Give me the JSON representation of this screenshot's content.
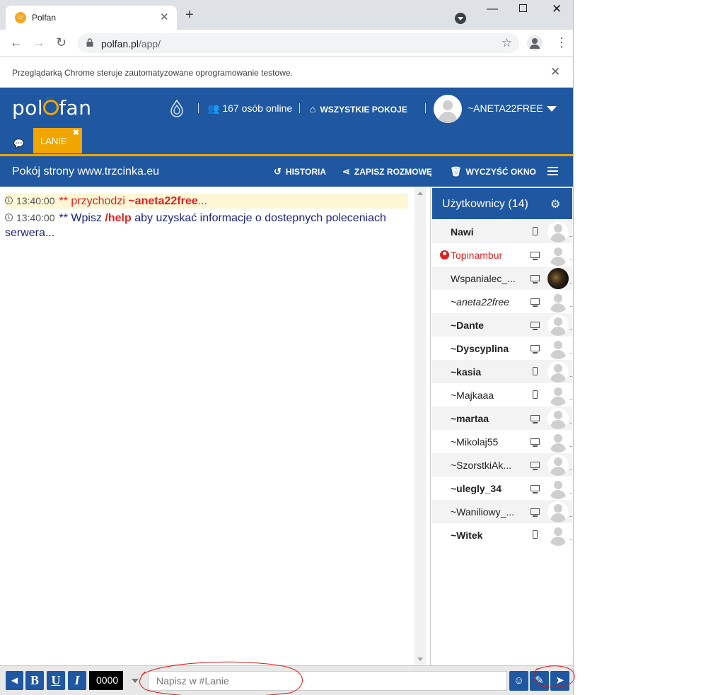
{
  "browser": {
    "tab_title": "Polfan",
    "tab_favicon": "polfan-favicon",
    "url_host": "polfan.pl",
    "url_path": "/app/",
    "infobar_text": "Przeglądarką Chrome steruje zautomatyzowane oprogramowanie testowe."
  },
  "header": {
    "logo": "polfan",
    "online_count": "167 osób online",
    "all_rooms": "WSZYSTKIE POKOJE",
    "username": "~ANETA22FREE",
    "room_tab": "LANIE"
  },
  "roombar": {
    "title": "Pokój strony www.trzcinka.eu",
    "history": "HISTORIA",
    "save": "ZAPISZ ROZMOWĘ",
    "clear": "WYCZYŚĆ OKNO"
  },
  "messages": [
    {
      "time": "13:40:00",
      "prefix": "** przychodzi ",
      "nick": "~aneta22free",
      "suffix": "..."
    },
    {
      "time": "13:40:00",
      "prefix": "** Wpisz ",
      "cmd": "/help",
      "suffix": " aby uzyskać informacje o dostepnych poleceniach serwera..."
    }
  ],
  "users_panel": {
    "title": "Użytkownicy (14)",
    "users": [
      {
        "name": "Nawi",
        "style": "bold",
        "device": "phone",
        "avatar": "default"
      },
      {
        "name": "Topinambur",
        "style": "red",
        "device": "pc",
        "avatar": "default",
        "status": "red-user-icon"
      },
      {
        "name": "Wspanialec_...",
        "style": "normal",
        "device": "pc",
        "avatar": "photo"
      },
      {
        "name": "~aneta22free",
        "style": "italic",
        "device": "pc",
        "avatar": "default"
      },
      {
        "name": "~Dante",
        "style": "bold",
        "device": "pc",
        "avatar": "default"
      },
      {
        "name": "~Dyscyplina",
        "style": "bold",
        "device": "pc",
        "avatar": "default"
      },
      {
        "name": "~kasia",
        "style": "bold",
        "device": "phone",
        "avatar": "default"
      },
      {
        "name": "~Majkaaa",
        "style": "normal",
        "device": "phone",
        "avatar": "default"
      },
      {
        "name": "~martaa",
        "style": "bold",
        "device": "pc",
        "avatar": "default"
      },
      {
        "name": "~Mikolaj55",
        "style": "normal",
        "device": "pc",
        "avatar": "default"
      },
      {
        "name": "~SzorstkiAk...",
        "style": "normal",
        "device": "pc",
        "avatar": "default"
      },
      {
        "name": "~uleg​ly_34",
        "style": "bold",
        "device": "pc",
        "avatar": "default"
      },
      {
        "name": "~Waniliowy_...",
        "style": "normal",
        "device": "pc",
        "avatar": "default"
      },
      {
        "name": "~Witek",
        "style": "bold",
        "device": "phone",
        "avatar": "default"
      }
    ]
  },
  "input_bar": {
    "bold": "B",
    "underline": "U",
    "italic": "I",
    "color_value": "0000",
    "placeholder": "Napisz w #Lanie"
  },
  "colors": {
    "brand_blue": "#1f57a0",
    "accent_orange": "#f0a500",
    "nick_red": "#e02020"
  }
}
